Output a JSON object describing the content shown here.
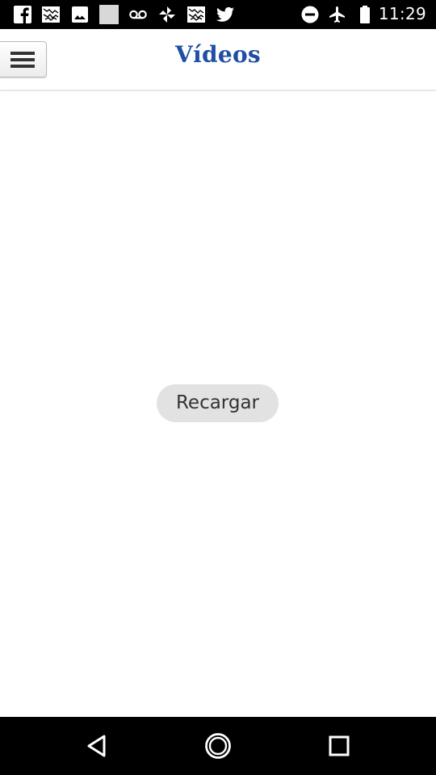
{
  "status_bar": {
    "left_icons": [
      "facebook-icon",
      "gallery-icon",
      "image-icon",
      "blank-notification-icon",
      "voicemail-icon",
      "pinwheel-icon",
      "gallery-icon",
      "twitter-icon"
    ],
    "right_icons": [
      "do-not-disturb-icon",
      "airplane-mode-icon",
      "battery-icon"
    ],
    "time": "11:29"
  },
  "app_bar": {
    "menu_icon": "hamburger-menu-icon",
    "title": "Vídeos",
    "title_color": "#1f4fa3"
  },
  "content": {
    "reload_label": "Recargar"
  },
  "nav_bar": {
    "buttons": [
      "back-icon",
      "home-icon",
      "recents-icon"
    ]
  }
}
